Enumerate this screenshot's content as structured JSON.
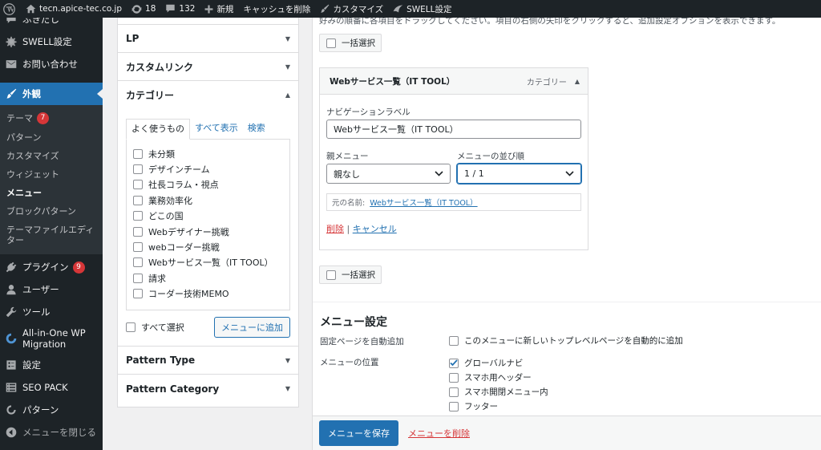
{
  "admin_bar": {
    "site_name": "tecn.apice-tec.co.jp",
    "updates_count": "18",
    "comments_count": "132",
    "new_label": "新規",
    "clear_cache_label": "キャッシュを削除",
    "customize_label": "カスタマイズ",
    "swell_label": "SWELL設定"
  },
  "sidebar": {
    "items_top": [
      {
        "label": "ふきだし",
        "icon": "speech-bubble-icon"
      },
      {
        "label": "SWELL設定",
        "icon": "gear-icon"
      },
      {
        "label": "お問い合わせ",
        "icon": "mail-icon"
      }
    ],
    "active_item": {
      "label": "外観",
      "icon": "paintbrush-icon"
    },
    "submenu": [
      {
        "label": "テーマ",
        "badge": "7"
      },
      {
        "label": "パターン"
      },
      {
        "label": "カスタマイズ"
      },
      {
        "label": "ウィジェット"
      },
      {
        "label": "メニュー",
        "current": true
      },
      {
        "label": "ブロックパターン"
      },
      {
        "label": "テーマファイルエディター"
      }
    ],
    "items_bottom": [
      {
        "label": "プラグイン",
        "icon": "plugin-icon",
        "badge": "9"
      },
      {
        "label": "ユーザー",
        "icon": "user-icon"
      },
      {
        "label": "ツール",
        "icon": "wrench-icon"
      },
      {
        "label": "All-in-One WP Migration",
        "icon": "migration-icon"
      },
      {
        "label": "設定",
        "icon": "settings-icon"
      },
      {
        "label": "SEO PACK",
        "icon": "list-icon"
      },
      {
        "label": "パターン",
        "icon": "patterns-icon"
      }
    ],
    "collapse_label": "メニューを閉じる"
  },
  "left_panel": {
    "sections": [
      "LP",
      "カスタムリンク",
      "カテゴリー"
    ],
    "tabs": [
      "よく使うもの",
      "すべて表示",
      "検索"
    ],
    "categories": [
      "未分類",
      "デザインチーム",
      "社長コラム・視点",
      "業務効率化",
      "どこの国",
      "Webデザイナー挑戦",
      "webコーダー挑戦",
      "Webサービス一覧（IT TOOL）",
      "請求",
      "コーダー技術MEMO"
    ],
    "select_all_label": "すべて選択",
    "add_to_menu_label": "メニューに追加",
    "bottom_sections": [
      "Pattern Type",
      "Pattern Category"
    ]
  },
  "right_panel": {
    "top_text": "好みの順番に各項目をドラッグしてください。項目の右側の矢印をクリックすると、追加設定オプションを表示できます。",
    "bulk_select_label": "一括選択",
    "menu_item": {
      "title": "Webサービス一覧（IT TOOL）",
      "type": "カテゴリー",
      "nav_label_caption": "ナビゲーションラベル",
      "nav_label_value": "Webサービス一覧（IT TOOL）",
      "parent_caption": "親メニュー",
      "parent_value": "親なし",
      "order_caption": "メニューの並び順",
      "order_value": "1 / 1",
      "original_caption": "元の名前:",
      "original_link": "Webサービス一覧（IT TOOL）",
      "delete_label": "削除",
      "separator": "|",
      "cancel_label": "キャンセル"
    },
    "settings": {
      "title": "メニュー設定",
      "auto_add_label": "固定ページを自動追加",
      "auto_add_option": "このメニューに新しいトップレベルページを自動的に追加",
      "location_label": "メニューの位置",
      "locations": [
        {
          "label": "グローバルナビ",
          "checked": true
        },
        {
          "label": "スマホ用ヘッダー",
          "checked": false
        },
        {
          "label": "スマホ開閉メニュー内",
          "checked": false
        },
        {
          "label": "フッター",
          "checked": false
        }
      ]
    },
    "save_label": "メニューを保存",
    "delete_menu_label": "メニューを削除"
  }
}
